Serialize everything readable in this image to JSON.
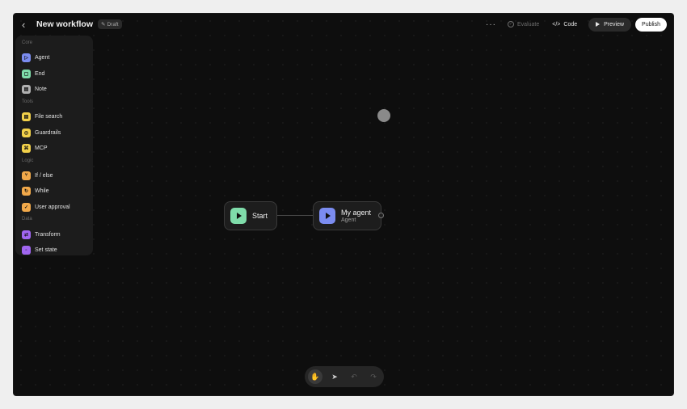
{
  "header": {
    "title": "New workflow",
    "badge": "Draft",
    "more": "···",
    "evaluate": "Evaluate",
    "code": "Code",
    "preview": "Preview",
    "publish": "Publish"
  },
  "sidebar": {
    "sections": [
      {
        "title": "Core",
        "items": [
          {
            "label": "Agent",
            "icon": "agent-icon",
            "color": "#7b8cf0",
            "glyph": "▷"
          },
          {
            "label": "End",
            "icon": "end-icon",
            "color": "#7fdcaa",
            "glyph": "▢"
          },
          {
            "label": "Note",
            "icon": "note-icon",
            "color": "#b0b0b0",
            "glyph": "▤"
          }
        ]
      },
      {
        "title": "Tools",
        "items": [
          {
            "label": "File search",
            "icon": "file-search-icon",
            "color": "#f2d14a",
            "glyph": "▤"
          },
          {
            "label": "Guardrails",
            "icon": "guardrails-icon",
            "color": "#f2d14a",
            "glyph": "◎"
          },
          {
            "label": "MCP",
            "icon": "mcp-icon",
            "color": "#f2d14a",
            "glyph": "⌘"
          }
        ]
      },
      {
        "title": "Logic",
        "items": [
          {
            "label": "If / else",
            "icon": "if-else-icon",
            "color": "#f2a94a",
            "glyph": "⑂"
          },
          {
            "label": "While",
            "icon": "while-icon",
            "color": "#f2a94a",
            "glyph": "↻"
          },
          {
            "label": "User approval",
            "icon": "user-approval-icon",
            "color": "#f2a94a",
            "glyph": "✓"
          }
        ]
      },
      {
        "title": "Data",
        "items": [
          {
            "label": "Transform",
            "icon": "transform-icon",
            "color": "#a066f0",
            "glyph": "⇄"
          },
          {
            "label": "Set state",
            "icon": "set-state-icon",
            "color": "#a066f0",
            "glyph": "▫"
          }
        ]
      }
    ]
  },
  "canvas": {
    "start_node": {
      "title": "Start",
      "icon": "play-icon",
      "color": "#7fdcaa"
    },
    "agent_node": {
      "title": "My agent",
      "subtitle": "Agent",
      "icon": "agent-icon",
      "color": "#7b8cf0"
    }
  },
  "toolbar": {
    "tools": [
      {
        "name": "pan-tool",
        "glyph": "✋",
        "active": true
      },
      {
        "name": "select-tool",
        "glyph": "➤",
        "active": false
      },
      {
        "name": "undo",
        "glyph": "↶",
        "disabled": true
      },
      {
        "name": "redo",
        "glyph": "↷",
        "disabled": true
      }
    ]
  }
}
